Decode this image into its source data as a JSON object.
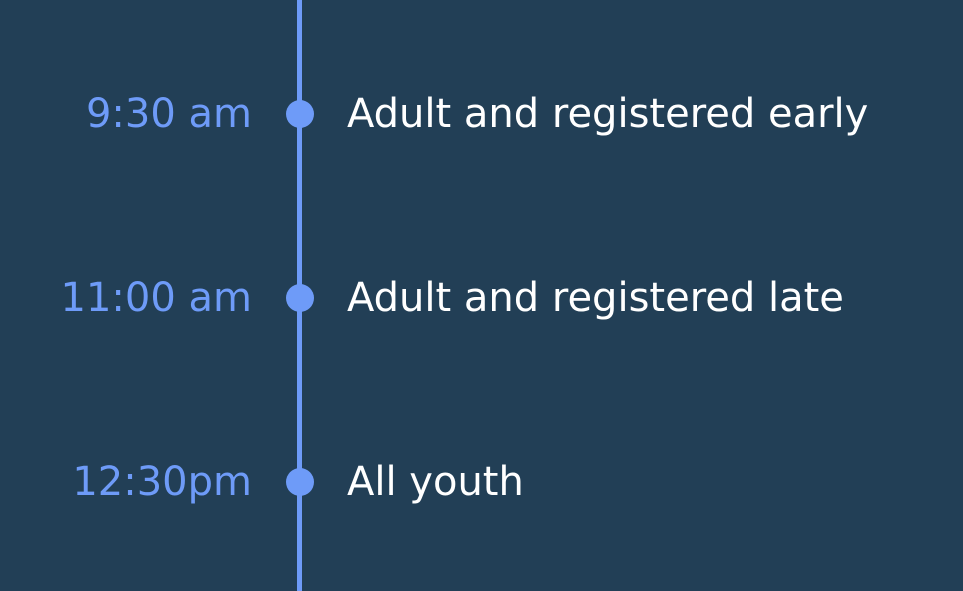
{
  "colors": {
    "background": "#223f56",
    "accent": "#6e9bf8",
    "text": "#ffffff"
  },
  "schedule": {
    "events": [
      {
        "time": "9:30 am",
        "title": "Adult and registered early"
      },
      {
        "time": "11:00 am",
        "title": "Adult and registered late"
      },
      {
        "time": "12:30pm",
        "title": "All youth"
      }
    ]
  }
}
